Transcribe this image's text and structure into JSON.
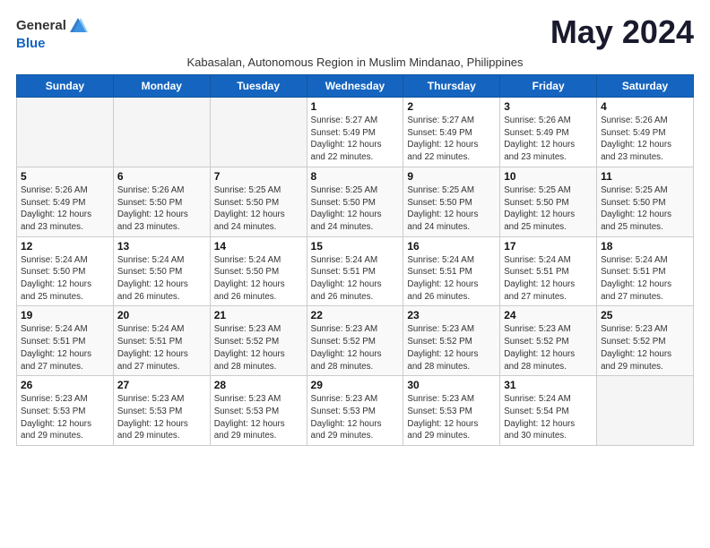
{
  "logo": {
    "general": "General",
    "blue": "Blue"
  },
  "title": "May 2024",
  "subtitle": "Kabasalan, Autonomous Region in Muslim Mindanao, Philippines",
  "days_header": [
    "Sunday",
    "Monday",
    "Tuesday",
    "Wednesday",
    "Thursday",
    "Friday",
    "Saturday"
  ],
  "weeks": [
    [
      {
        "day": "",
        "detail": ""
      },
      {
        "day": "",
        "detail": ""
      },
      {
        "day": "",
        "detail": ""
      },
      {
        "day": "1",
        "detail": "Sunrise: 5:27 AM\nSunset: 5:49 PM\nDaylight: 12 hours\nand 22 minutes."
      },
      {
        "day": "2",
        "detail": "Sunrise: 5:27 AM\nSunset: 5:49 PM\nDaylight: 12 hours\nand 22 minutes."
      },
      {
        "day": "3",
        "detail": "Sunrise: 5:26 AM\nSunset: 5:49 PM\nDaylight: 12 hours\nand 23 minutes."
      },
      {
        "day": "4",
        "detail": "Sunrise: 5:26 AM\nSunset: 5:49 PM\nDaylight: 12 hours\nand 23 minutes."
      }
    ],
    [
      {
        "day": "5",
        "detail": "Sunrise: 5:26 AM\nSunset: 5:49 PM\nDaylight: 12 hours\nand 23 minutes."
      },
      {
        "day": "6",
        "detail": "Sunrise: 5:26 AM\nSunset: 5:50 PM\nDaylight: 12 hours\nand 23 minutes."
      },
      {
        "day": "7",
        "detail": "Sunrise: 5:25 AM\nSunset: 5:50 PM\nDaylight: 12 hours\nand 24 minutes."
      },
      {
        "day": "8",
        "detail": "Sunrise: 5:25 AM\nSunset: 5:50 PM\nDaylight: 12 hours\nand 24 minutes."
      },
      {
        "day": "9",
        "detail": "Sunrise: 5:25 AM\nSunset: 5:50 PM\nDaylight: 12 hours\nand 24 minutes."
      },
      {
        "day": "10",
        "detail": "Sunrise: 5:25 AM\nSunset: 5:50 PM\nDaylight: 12 hours\nand 25 minutes."
      },
      {
        "day": "11",
        "detail": "Sunrise: 5:25 AM\nSunset: 5:50 PM\nDaylight: 12 hours\nand 25 minutes."
      }
    ],
    [
      {
        "day": "12",
        "detail": "Sunrise: 5:24 AM\nSunset: 5:50 PM\nDaylight: 12 hours\nand 25 minutes."
      },
      {
        "day": "13",
        "detail": "Sunrise: 5:24 AM\nSunset: 5:50 PM\nDaylight: 12 hours\nand 26 minutes."
      },
      {
        "day": "14",
        "detail": "Sunrise: 5:24 AM\nSunset: 5:50 PM\nDaylight: 12 hours\nand 26 minutes."
      },
      {
        "day": "15",
        "detail": "Sunrise: 5:24 AM\nSunset: 5:51 PM\nDaylight: 12 hours\nand 26 minutes."
      },
      {
        "day": "16",
        "detail": "Sunrise: 5:24 AM\nSunset: 5:51 PM\nDaylight: 12 hours\nand 26 minutes."
      },
      {
        "day": "17",
        "detail": "Sunrise: 5:24 AM\nSunset: 5:51 PM\nDaylight: 12 hours\nand 27 minutes."
      },
      {
        "day": "18",
        "detail": "Sunrise: 5:24 AM\nSunset: 5:51 PM\nDaylight: 12 hours\nand 27 minutes."
      }
    ],
    [
      {
        "day": "19",
        "detail": "Sunrise: 5:24 AM\nSunset: 5:51 PM\nDaylight: 12 hours\nand 27 minutes."
      },
      {
        "day": "20",
        "detail": "Sunrise: 5:24 AM\nSunset: 5:51 PM\nDaylight: 12 hours\nand 27 minutes."
      },
      {
        "day": "21",
        "detail": "Sunrise: 5:23 AM\nSunset: 5:52 PM\nDaylight: 12 hours\nand 28 minutes."
      },
      {
        "day": "22",
        "detail": "Sunrise: 5:23 AM\nSunset: 5:52 PM\nDaylight: 12 hours\nand 28 minutes."
      },
      {
        "day": "23",
        "detail": "Sunrise: 5:23 AM\nSunset: 5:52 PM\nDaylight: 12 hours\nand 28 minutes."
      },
      {
        "day": "24",
        "detail": "Sunrise: 5:23 AM\nSunset: 5:52 PM\nDaylight: 12 hours\nand 28 minutes."
      },
      {
        "day": "25",
        "detail": "Sunrise: 5:23 AM\nSunset: 5:52 PM\nDaylight: 12 hours\nand 29 minutes."
      }
    ],
    [
      {
        "day": "26",
        "detail": "Sunrise: 5:23 AM\nSunset: 5:53 PM\nDaylight: 12 hours\nand 29 minutes."
      },
      {
        "day": "27",
        "detail": "Sunrise: 5:23 AM\nSunset: 5:53 PM\nDaylight: 12 hours\nand 29 minutes."
      },
      {
        "day": "28",
        "detail": "Sunrise: 5:23 AM\nSunset: 5:53 PM\nDaylight: 12 hours\nand 29 minutes."
      },
      {
        "day": "29",
        "detail": "Sunrise: 5:23 AM\nSunset: 5:53 PM\nDaylight: 12 hours\nand 29 minutes."
      },
      {
        "day": "30",
        "detail": "Sunrise: 5:23 AM\nSunset: 5:53 PM\nDaylight: 12 hours\nand 29 minutes."
      },
      {
        "day": "31",
        "detail": "Sunrise: 5:24 AM\nSunset: 5:54 PM\nDaylight: 12 hours\nand 30 minutes."
      },
      {
        "day": "",
        "detail": ""
      }
    ]
  ]
}
